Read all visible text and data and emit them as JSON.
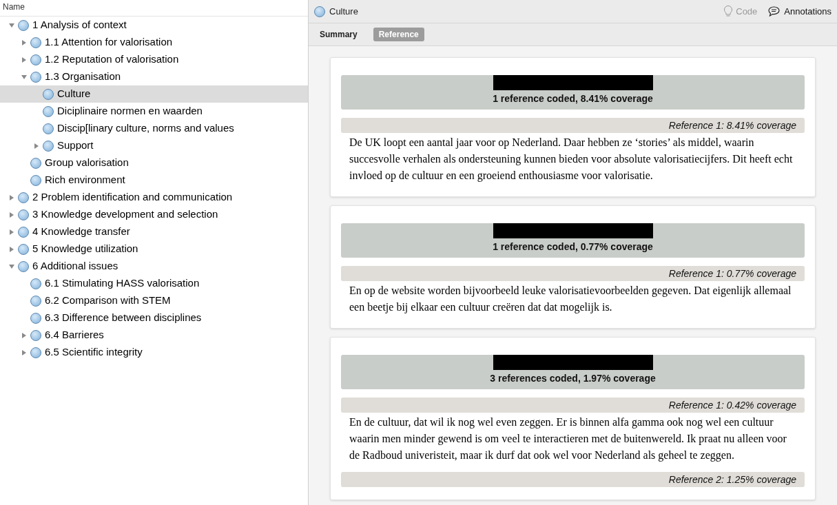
{
  "tree": {
    "header": "Name",
    "items": [
      {
        "label": "1 Analysis of context",
        "expanded": true,
        "selected": false,
        "children": [
          {
            "label": "1.1 Attention for valorisation",
            "expanded": false,
            "selected": false
          },
          {
            "label": "1.2 Reputation of valorisation",
            "expanded": false,
            "selected": false
          },
          {
            "label": "1.3 Organisation",
            "expanded": true,
            "selected": false,
            "children": [
              {
                "label": "Culture",
                "selected": true
              },
              {
                "label": "Diciplinaire normen en waarden",
                "selected": false
              },
              {
                "label": "Discip[linary culture, norms and values",
                "selected": false
              },
              {
                "label": "Support",
                "expanded": false,
                "selected": false
              }
            ]
          },
          {
            "label": "Group valorisation",
            "selected": false
          },
          {
            "label": "Rich environment",
            "selected": false
          }
        ]
      },
      {
        "label": "2 Problem identification and communication",
        "expanded": false,
        "selected": false
      },
      {
        "label": "3 Knowledge development and selection",
        "expanded": false,
        "selected": false
      },
      {
        "label": "4 Knowledge transfer",
        "expanded": false,
        "selected": false
      },
      {
        "label": "5 Knowledge utilization",
        "expanded": false,
        "selected": false
      },
      {
        "label": "6 Additional issues",
        "expanded": true,
        "selected": false,
        "children": [
          {
            "label": "6.1 Stimulating HASS valorisation",
            "selected": false
          },
          {
            "label": "6.2 Comparison with STEM",
            "selected": false
          },
          {
            "label": "6.3 Difference between disciplines",
            "selected": false
          },
          {
            "label": "6.4 Barrieres",
            "expanded": false,
            "selected": false
          },
          {
            "label": "6.5 Scientific integrity",
            "expanded": false,
            "selected": false
          }
        ]
      }
    ]
  },
  "detail": {
    "title": "Culture",
    "code_button": {
      "label": "Code",
      "disabled": true
    },
    "annotations_button": {
      "label": "Annotations"
    },
    "tabs": [
      {
        "label": "Summary",
        "selected": false
      },
      {
        "label": "Reference",
        "selected": true
      }
    ],
    "cards": [
      {
        "summary": "1 reference coded, 8.41% coverage",
        "references": [
          {
            "label": "Reference 1: 8.41% coverage",
            "text": "De UK loopt een aantal jaar voor op Nederland. Daar hebben ze ‘stories’ als middel, waarin succesvolle verhalen als ondersteuning kunnen bieden voor absolute valorisatiecijfers. Dit heeft echt invloed op de cultuur en een groeiend enthousiasme voor valorisatie."
          }
        ]
      },
      {
        "summary": "1 reference coded, 0.77% coverage",
        "references": [
          {
            "label": "Reference 1: 0.77% coverage",
            "text": "En op de website worden bijvoorbeeld leuke valorisatievoorbeelden gegeven. Dat eigenlijk allemaal een beetje bij elkaar een cultuur creëren dat dat mogelijk is."
          }
        ]
      },
      {
        "summary": "3 references coded, 1.97% coverage",
        "references": [
          {
            "label": "Reference 1: 0.42% coverage",
            "text": "En de cultuur, dat wil ik nog wel even zeggen. Er is binnen alfa gamma ook nog wel een cultuur waarin men minder gewend is om veel te interactieren met de buitenwereld. Ik praat nu alleen voor de Radboud univeristeit, maar ik durf dat ook wel voor Nederland als geheel te zeggen."
          },
          {
            "label": "Reference 2: 1.25% coverage"
          }
        ]
      }
    ]
  }
}
